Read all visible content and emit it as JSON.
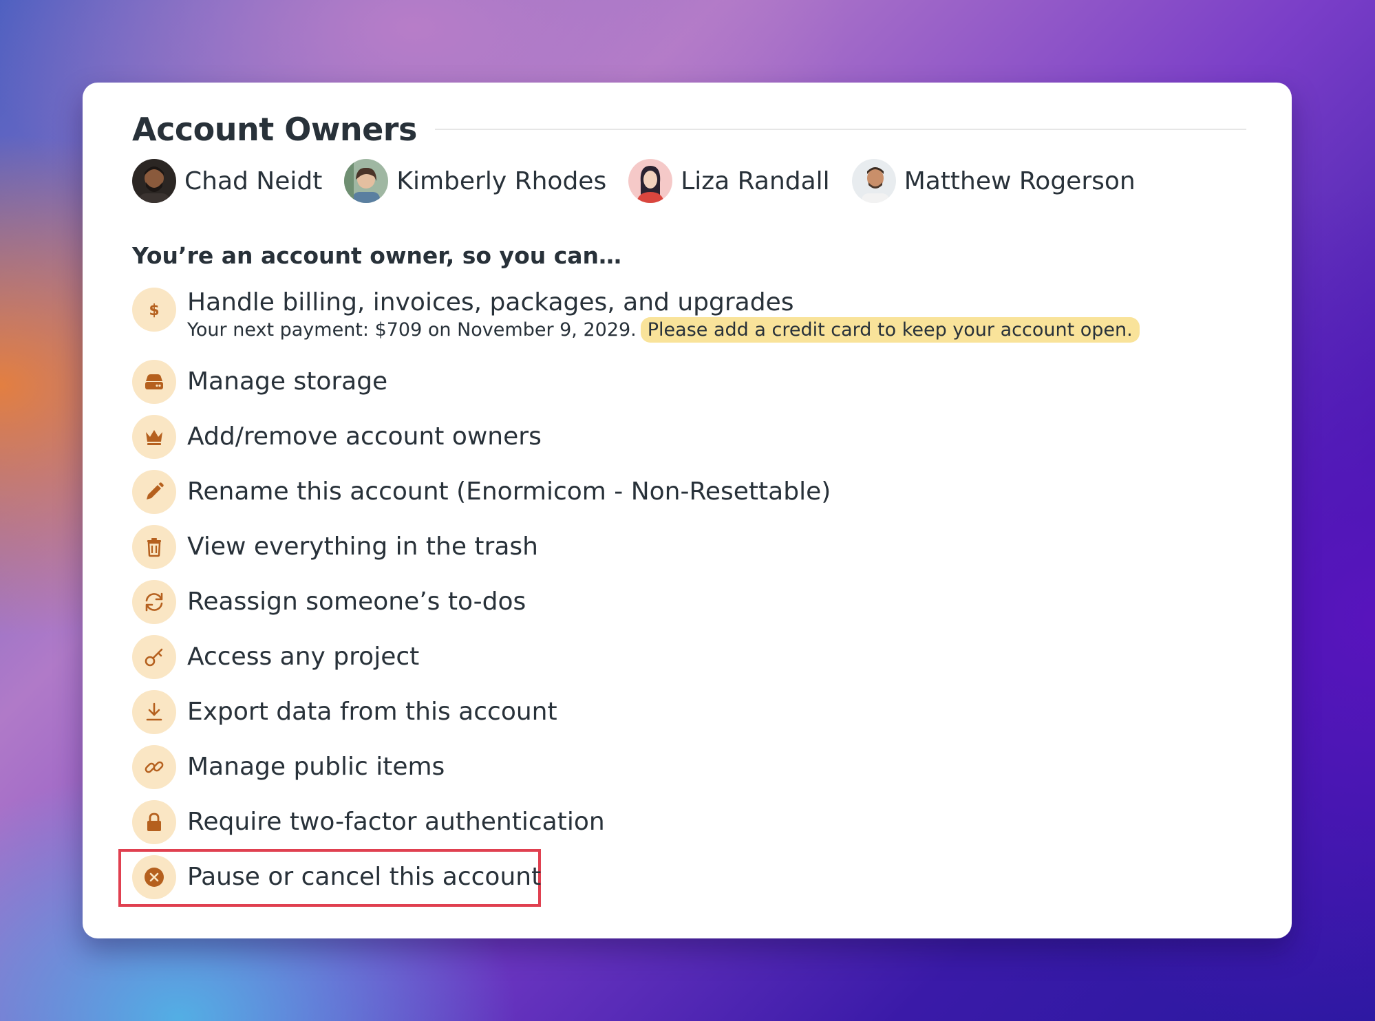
{
  "section_title": "Account Owners",
  "owners": [
    {
      "name": "Chad Neidt"
    },
    {
      "name": "Kimberly Rhodes"
    },
    {
      "name": "Liza Randall"
    },
    {
      "name": "Matthew Rogerson"
    }
  ],
  "subheading": "You’re an account owner, so you can…",
  "permissions": {
    "billing": {
      "label": "Handle billing, invoices, packages, and upgrades",
      "note": "Your next payment: $709 on November 9, 2029.",
      "alert": "Please add a credit card to keep your account open.",
      "icon": "dollar-icon"
    },
    "storage": {
      "label": "Manage storage",
      "icon": "storage-icon"
    },
    "owners": {
      "label": "Add/remove account owners",
      "icon": "crown-icon"
    },
    "rename": {
      "label": "Rename this account (Enormicom - Non-Resettable)",
      "icon": "pencil-icon"
    },
    "trash": {
      "label": "View everything in the trash",
      "icon": "trash-icon"
    },
    "reassign": {
      "label": "Reassign someone’s to-dos",
      "icon": "refresh-icon"
    },
    "access": {
      "label": "Access any project",
      "icon": "key-icon"
    },
    "export": {
      "label": "Export data from this account",
      "icon": "download-icon"
    },
    "public": {
      "label": "Manage public items",
      "icon": "link-icon"
    },
    "twofactor": {
      "label": "Require two-factor authentication",
      "icon": "lock-icon"
    },
    "cancel": {
      "label": "Pause or cancel this account",
      "icon": "close-circle-icon"
    }
  },
  "colors": {
    "icon_bg": "#fae6c4",
    "icon_fg": "#b5601e",
    "alert_bg": "#f9e39a",
    "highlight_border": "#e04050",
    "text": "#283139"
  }
}
